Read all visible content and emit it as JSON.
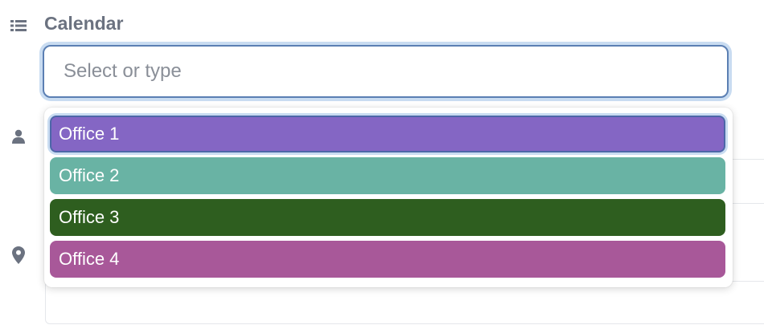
{
  "calendar": {
    "label": "Calendar",
    "icon": "list-icon",
    "select": {
      "placeholder": "Select or type",
      "value": ""
    },
    "options": [
      {
        "label": "Office 1",
        "color": "#8466c4",
        "highlighted": true
      },
      {
        "label": "Office 2",
        "color": "#69b3a4",
        "highlighted": false
      },
      {
        "label": "Office 3",
        "color": "#2e5e1f",
        "highlighted": false
      },
      {
        "label": "Office 4",
        "color": "#a85899",
        "highlighted": false
      }
    ]
  },
  "person_row": {
    "icon": "person-icon"
  },
  "location_row": {
    "icon": "location-pin-icon"
  }
}
